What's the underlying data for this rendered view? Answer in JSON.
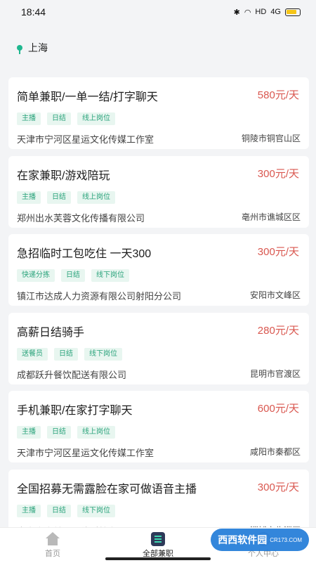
{
  "status_bar": {
    "time": "18:44",
    "network": "HD",
    "signal": "4G"
  },
  "location": {
    "city": "上海"
  },
  "jobs": [
    {
      "title": "简单兼职/一单一结/打字聊天",
      "price": "580元/天",
      "tags": [
        "主播",
        "日结",
        "线上岗位"
      ],
      "company": "天津市宁河区星运文化传媒工作室",
      "region": "铜陵市铜官山区"
    },
    {
      "title": "在家兼职/游戏陪玩",
      "price": "300元/天",
      "tags": [
        "主播",
        "日结",
        "线上岗位"
      ],
      "company": "郑州出水芙蓉文化传播有限公司",
      "region": "亳州市谯城区区"
    },
    {
      "title": "急招临时工包吃住 一天300",
      "price": "300元/天",
      "tags": [
        "快递分拣",
        "日结",
        "线下岗位"
      ],
      "company": "镇江市达成人力资源有限公司射阳分公司",
      "region": "安阳市文峰区"
    },
    {
      "title": "高薪日结骑手",
      "price": "280元/天",
      "tags": [
        "送餐员",
        "日结",
        "线下岗位"
      ],
      "company": "成都跃升餐饮配送有限公司",
      "region": "昆明市官渡区"
    },
    {
      "title": "手机兼职/在家打字聊天",
      "price": "600元/天",
      "tags": [
        "主播",
        "日结",
        "线上岗位"
      ],
      "company": "天津市宁河区星运文化传媒工作室",
      "region": "咸阳市秦都区"
    },
    {
      "title": "全国招募无需露脸在家可做语音主播",
      "price": "300元/天",
      "tags": [
        "主播",
        "日结",
        "线下岗位"
      ],
      "company": "南京今高美通网络科技有限公司",
      "region": "淄博市临淄区"
    }
  ],
  "tabbar": {
    "home": "首页",
    "all_jobs": "全部兼职",
    "profile": "个人中心"
  },
  "watermark": {
    "text": "西西软件园",
    "sub": "CR173.COM"
  }
}
